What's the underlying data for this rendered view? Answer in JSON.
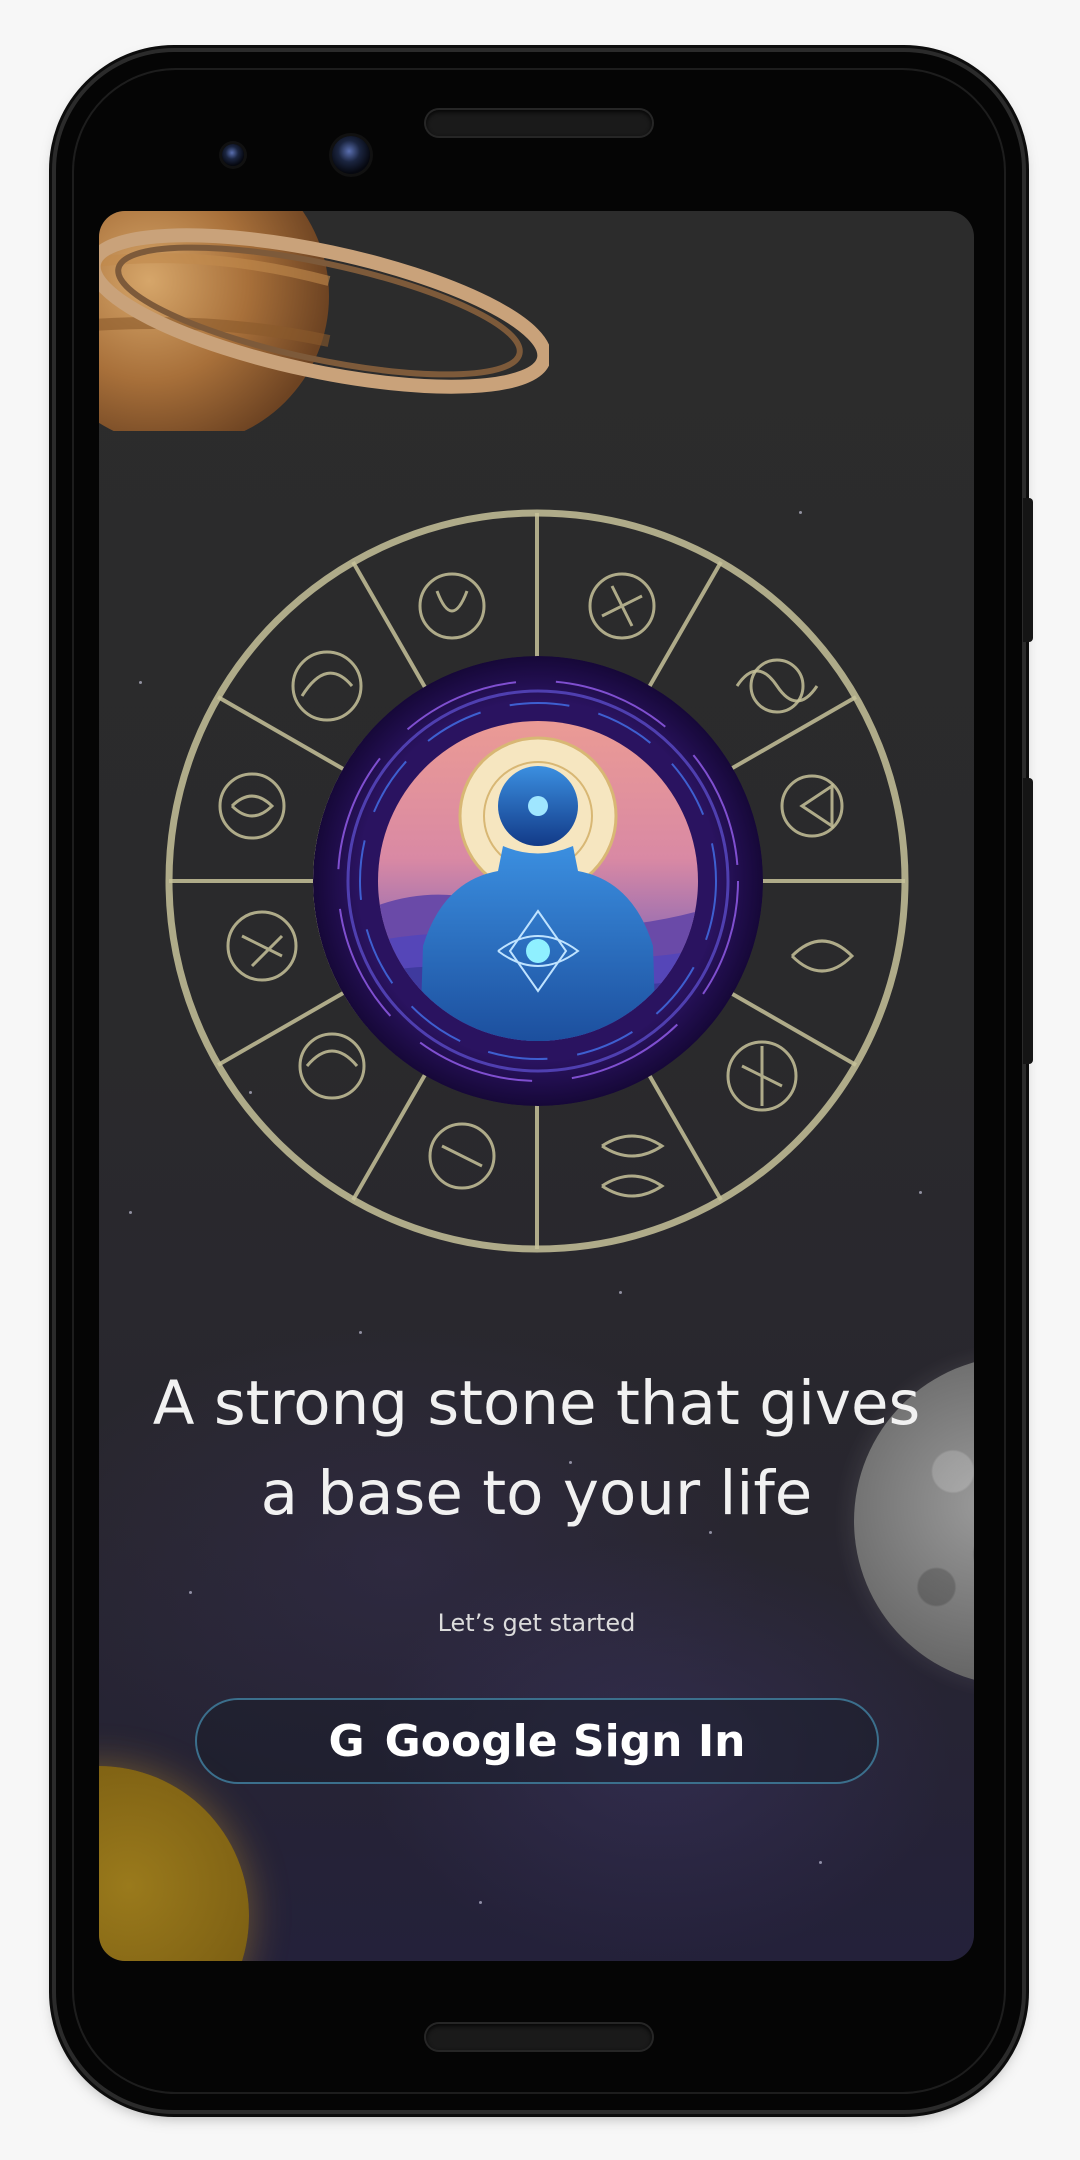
{
  "onboarding": {
    "headline": "A strong stone that gives\na base to your life",
    "subtitle": "Let’s get started",
    "sign_in_icon": "G",
    "sign_in_label": "Google Sign In"
  },
  "decor": {
    "icons": [
      "saturn-icon",
      "zodiac-wheel-icon",
      "meditation-figure-icon",
      "moon-icon",
      "sun-icon"
    ]
  },
  "colors": {
    "button_border": "#3b6f8c",
    "background": "#2a2a2c",
    "wheel_line": "#c7c29a"
  }
}
